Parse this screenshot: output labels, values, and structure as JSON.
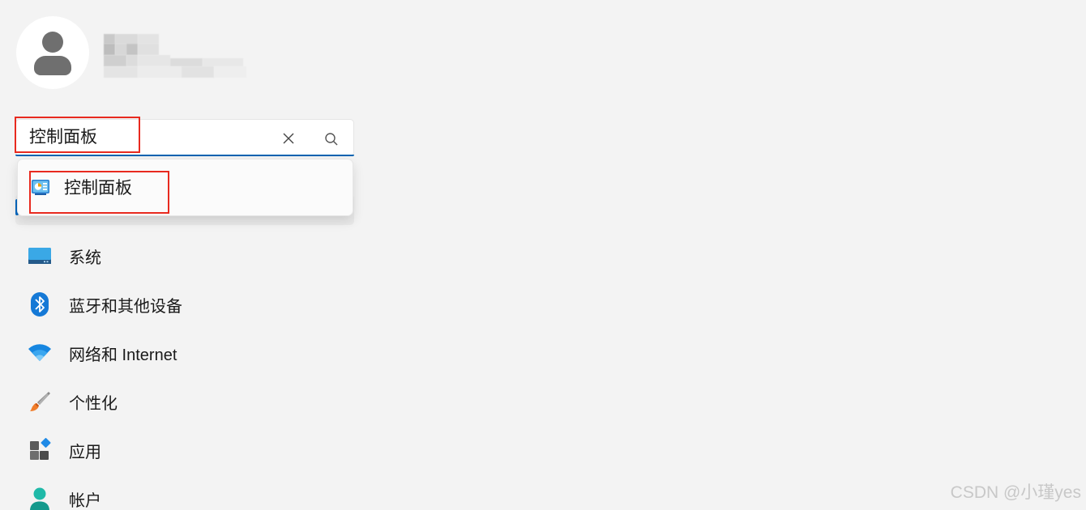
{
  "search": {
    "value": "控制面板",
    "clear_icon": "close-icon",
    "search_icon": "search-icon"
  },
  "suggestion": {
    "label": "控制面板",
    "icon": "control-panel-icon"
  },
  "nav": {
    "items": [
      {
        "label": "系统",
        "icon": "system-icon"
      },
      {
        "label": "蓝牙和其他设备",
        "icon": "bluetooth-icon"
      },
      {
        "label": "网络和 Internet",
        "icon": "wifi-icon"
      },
      {
        "label": "个性化",
        "icon": "brush-icon"
      },
      {
        "label": "应用",
        "icon": "apps-icon"
      },
      {
        "label": "帐户",
        "icon": "account-icon"
      }
    ]
  },
  "watermark": "CSDN @小瑾yes",
  "colors": {
    "accent": "#0063b1",
    "highlight": "#e82a1f",
    "background": "#f3f3f3"
  }
}
